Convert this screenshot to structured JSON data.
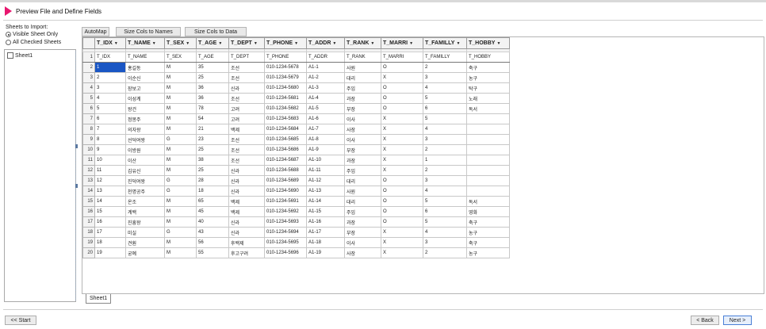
{
  "header": {
    "title": "Preview File and Define Fields"
  },
  "left": {
    "sheets_label": "Sheets to Import:",
    "radio_visible": "Visible Sheet Only",
    "radio_all": "All Checked Sheets",
    "sheets": [
      "Sheet1"
    ]
  },
  "toolbar": {
    "automap": "AutoMap",
    "size_names": "Size Cols to Names",
    "size_data": "Size Cols to Data"
  },
  "columns": [
    "T_IDX",
    "T_NAME",
    "T_SEX",
    "T_AGE",
    "T_DEPT",
    "T_PHONE",
    "T_ADDR",
    "T_RANK",
    "T_MARRI",
    "T_FAMILLY",
    "T_HOBBY"
  ],
  "rows": [
    [
      "T_IDX",
      "T_NAME",
      "T_SEX",
      "T_AGE",
      "T_DEPT",
      "T_PHONE",
      "T_ADDR",
      "T_RANK",
      "T_MARRI",
      "T_FAMILLY",
      "T_HOBBY"
    ],
    [
      "1",
      "홍길동",
      "M",
      "35",
      "조선",
      "010-1234-5678",
      "A1-1",
      "사원",
      "O",
      "2",
      "축구"
    ],
    [
      "2",
      "이순신",
      "M",
      "25",
      "조선",
      "010-1234-5679",
      "A1-2",
      "대리",
      "X",
      "3",
      "농구"
    ],
    [
      "3",
      "장보고",
      "M",
      "36",
      "신라",
      "010-1234-5680",
      "A1-3",
      "주임",
      "O",
      "4",
      "탁구"
    ],
    [
      "4",
      "이성계",
      "M",
      "36",
      "조선",
      "010-1234-5681",
      "A1-4",
      "과장",
      "O",
      "5",
      "노래"
    ],
    [
      "5",
      "왕건",
      "M",
      "78",
      "고려",
      "010-1234-5682",
      "A1-5",
      "부장",
      "O",
      "6",
      "독서"
    ],
    [
      "6",
      "정몽주",
      "M",
      "54",
      "고려",
      "010-1234-5683",
      "A1-6",
      "이사",
      "X",
      "5",
      ""
    ],
    [
      "7",
      "의자왕",
      "M",
      "21",
      "백제",
      "010-1234-5684",
      "A1-7",
      "사장",
      "X",
      "4",
      ""
    ],
    [
      "8",
      "선덕여왕",
      "G",
      "23",
      "조선",
      "010-1234-5685",
      "A1-8",
      "이사",
      "X",
      "3",
      ""
    ],
    [
      "9",
      "이방원",
      "M",
      "25",
      "조선",
      "010-1234-5686",
      "A1-9",
      "부장",
      "X",
      "2",
      ""
    ],
    [
      "10",
      "이산",
      "M",
      "38",
      "조선",
      "010-1234-5687",
      "A1-10",
      "과장",
      "X",
      "1",
      ""
    ],
    [
      "11",
      "김유신",
      "M",
      "25",
      "신라",
      "010-1234-5688",
      "A1-11",
      "주임",
      "X",
      "2",
      ""
    ],
    [
      "12",
      "진덕여왕",
      "G",
      "28",
      "신라",
      "010-1234-5689",
      "A1-12",
      "대리",
      "O",
      "3",
      ""
    ],
    [
      "13",
      "천명공주",
      "G",
      "18",
      "신라",
      "010-1234-5690",
      "A1-13",
      "사원",
      "O",
      "4",
      ""
    ],
    [
      "14",
      "온조",
      "M",
      "65",
      "백제",
      "010-1234-5691",
      "A1-14",
      "대리",
      "O",
      "5",
      "독서"
    ],
    [
      "15",
      "계백",
      "M",
      "45",
      "백제",
      "010-1234-5692",
      "A1-15",
      "주임",
      "O",
      "6",
      "영화"
    ],
    [
      "16",
      "진흥왕",
      "M",
      "40",
      "신라",
      "010-1234-5693",
      "A1-16",
      "과장",
      "O",
      "5",
      "축구"
    ],
    [
      "17",
      "미실",
      "G",
      "43",
      "신라",
      "010-1234-5694",
      "A1-17",
      "부장",
      "X",
      "4",
      "농구"
    ],
    [
      "18",
      "견훤",
      "M",
      "56",
      "후백제",
      "010-1234-5695",
      "A1-18",
      "이사",
      "X",
      "3",
      "축구"
    ],
    [
      "19",
      "궁예",
      "M",
      "55",
      "후고구려",
      "010-1234-5696",
      "A1-19",
      "사장",
      "X",
      "2",
      "농구"
    ]
  ],
  "tab": "Sheet1",
  "footer": {
    "start": "<< Start",
    "back": "< Back",
    "next": "Next >"
  },
  "colors": {
    "accent": "#e8176f",
    "selection": "#1a56c4"
  }
}
